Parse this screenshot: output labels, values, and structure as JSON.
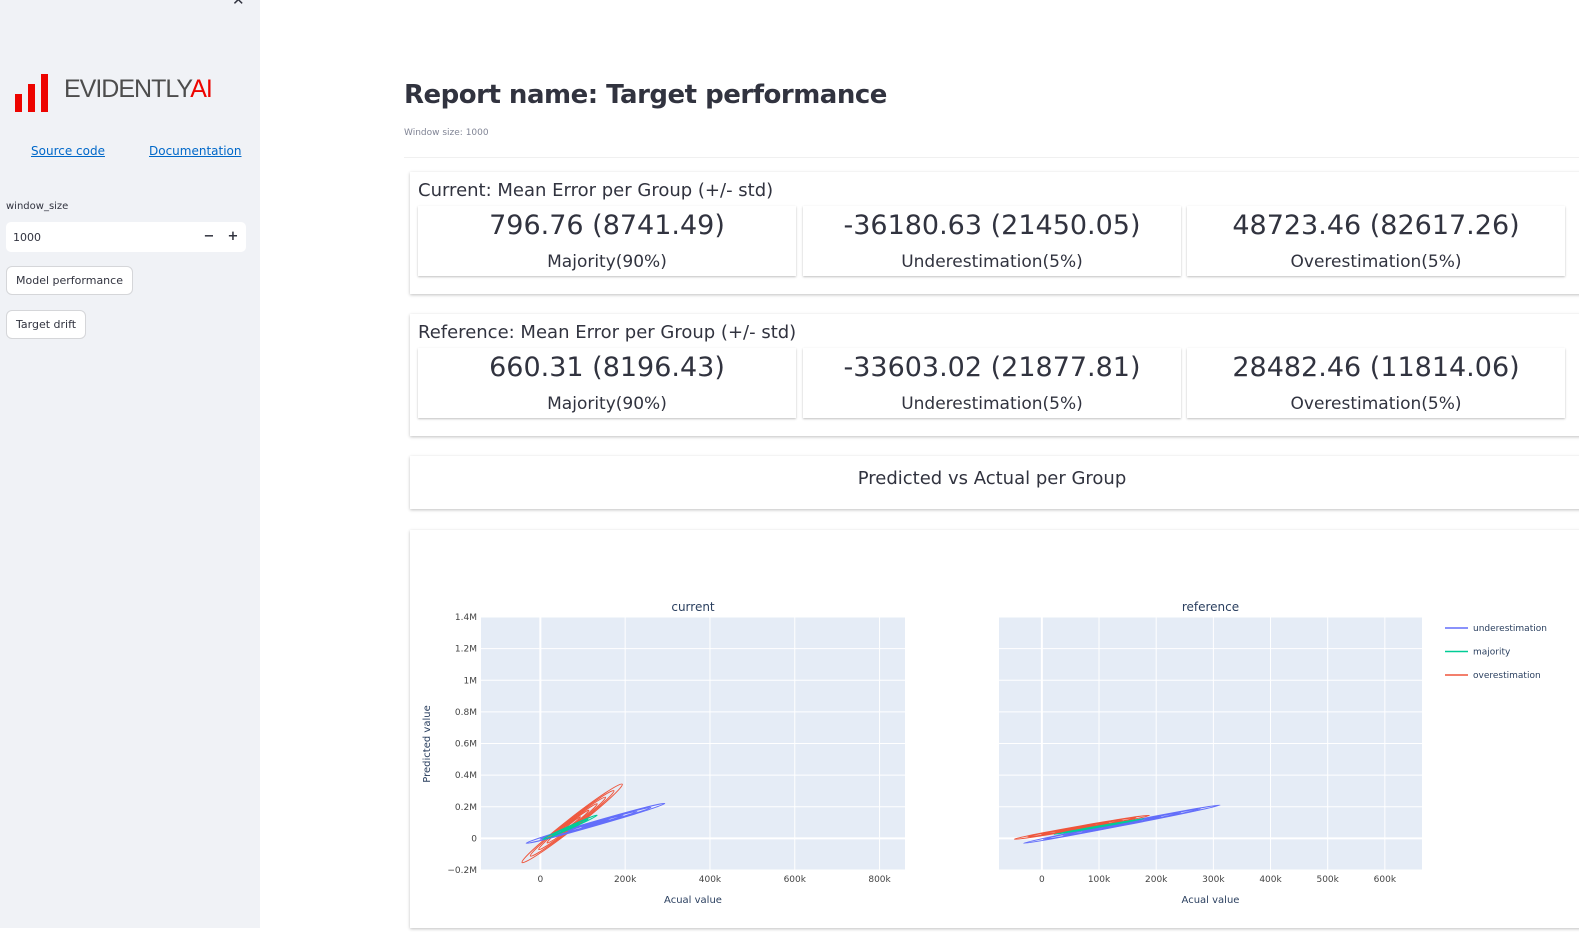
{
  "sidebar": {
    "close_icon": "close-icon",
    "logo": {
      "word": "EVIDENTLY",
      "accent": "AI",
      "brand_color": "#ed0400"
    },
    "links": {
      "source_code": "Source code",
      "documentation": "Documentation"
    },
    "window_size": {
      "label": "window_size",
      "value": "1000",
      "minus": "−",
      "plus": "+"
    },
    "buttons": {
      "model_performance": "Model performance",
      "target_drift": "Target drift"
    }
  },
  "main": {
    "title": "Report name: Target performance",
    "caption": "Window size: 1000",
    "current": {
      "title": "Current: Mean Error per Group (+/- std)",
      "cards": [
        {
          "value": "796.76 (8741.49)",
          "label": "Majority(90%)"
        },
        {
          "value": "-36180.63 (21450.05)",
          "label": "Underestimation(5%)"
        },
        {
          "value": "48723.46 (82617.26)",
          "label": "Overestimation(5%)"
        }
      ]
    },
    "reference": {
      "title": "Reference: Mean Error per Group (+/- std)",
      "cards": [
        {
          "value": "660.31 (8196.43)",
          "label": "Majority(90%)"
        },
        {
          "value": "-33603.02 (21877.81)",
          "label": "Underestimation(5%)"
        },
        {
          "value": "28482.46 (11814.06)",
          "label": "Overestimation(5%)"
        }
      ]
    },
    "pva_title": "Predicted vs Actual per Group"
  },
  "chart_data": {
    "type": "contour",
    "y_label": "Predicted value",
    "legend": {
      "placement": "right",
      "items": [
        {
          "name": "underestimation",
          "color": "#636efa"
        },
        {
          "name": "majority",
          "color": "#00cc96"
        },
        {
          "name": "overestimation",
          "color": "#ef553b"
        }
      ]
    },
    "y_ticks": [
      "1.4M",
      "1.2M",
      "1M",
      "0.8M",
      "0.6M",
      "0.4M",
      "0.2M",
      "0",
      "−0.2M"
    ],
    "grid": true,
    "subplots": [
      {
        "title": "current",
        "x_label": "Acual value",
        "x_ticks": [
          "0",
          "200k",
          "400k",
          "600k",
          "800k"
        ],
        "xlim": [
          -140000,
          860000
        ],
        "ylim": [
          -200000,
          1400000
        ]
      },
      {
        "title": "reference",
        "x_label": "Acual value",
        "x_ticks": [
          "0",
          "100k",
          "200k",
          "300k",
          "400k",
          "500k",
          "600k"
        ],
        "xlim": [
          -75000,
          665000
        ],
        "ylim": [
          -200000,
          1400000
        ]
      }
    ]
  }
}
